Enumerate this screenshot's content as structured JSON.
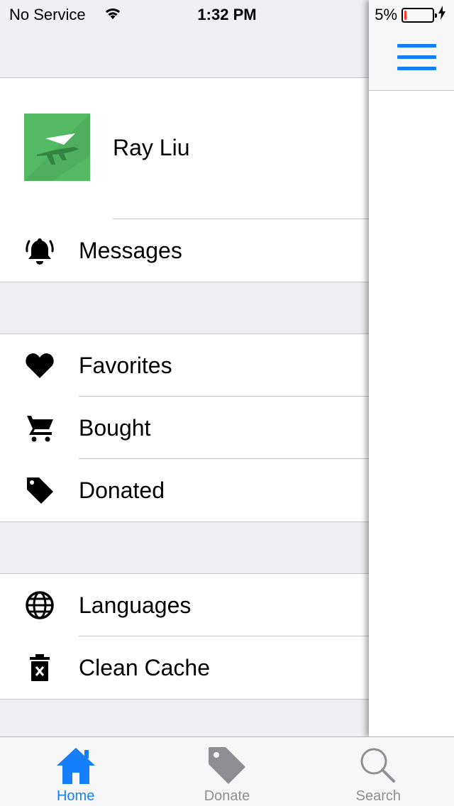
{
  "status_bar": {
    "carrier": "No Service",
    "time": "1:32 PM",
    "battery_percent": "5%",
    "battery_level": 0.05,
    "wifi_icon": "wifi-icon",
    "charging_icon": "bolt-icon"
  },
  "profile": {
    "name": "Ray Liu",
    "avatar_icon": "paper-plane-avatar"
  },
  "menu": {
    "messages": {
      "label": "Messages",
      "icon": "bell-icon"
    },
    "favorites": {
      "label": "Favorites",
      "icon": "heart-icon"
    },
    "bought": {
      "label": "Bought",
      "icon": "cart-icon"
    },
    "donated": {
      "label": "Donated",
      "icon": "tag-icon"
    },
    "languages": {
      "label": "Languages",
      "icon": "globe-icon"
    },
    "clean_cache": {
      "label": "Clean Cache",
      "icon": "trash-icon"
    }
  },
  "main_panel": {
    "menu_icon": "hamburger-icon"
  },
  "tab_bar": {
    "tabs": [
      {
        "label": "Home",
        "icon": "home-icon",
        "active": true
      },
      {
        "label": "Donate",
        "icon": "tag-icon",
        "active": false
      },
      {
        "label": "Search",
        "icon": "search-icon",
        "active": false
      }
    ]
  },
  "colors": {
    "accent": "#147efb",
    "inactive": "#8e8e93",
    "avatar_bg": "#53b962",
    "group_bg": "#efeff4",
    "battery_low": "#ff3b30"
  }
}
